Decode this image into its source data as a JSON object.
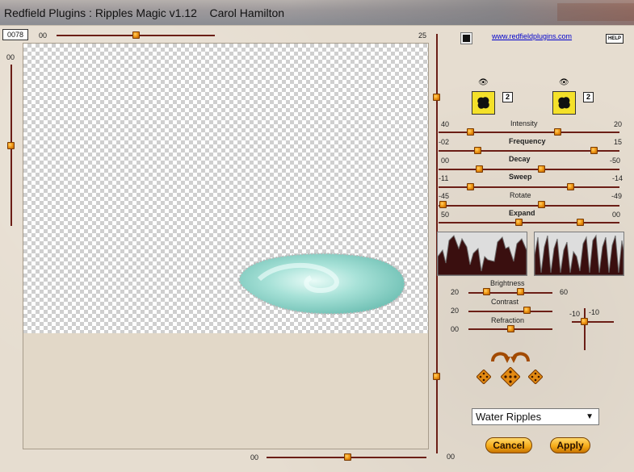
{
  "window": {
    "title": "Redfield Plugins : Ripples Magic v1.12    Carol Hamilton"
  },
  "top_controls": {
    "frame_box": "0078",
    "h_slider_min": "00",
    "h_slider_max": "25",
    "h_slider_value_fraction": 0.5,
    "v_slider_label": "00"
  },
  "bottom_controls": {
    "h_slider_label": "00",
    "right_label": "00"
  },
  "header_right": {
    "link": "www.redfieldplugins.com",
    "help": "HELP"
  },
  "presets": {
    "left_number": "2",
    "right_number": "2"
  },
  "params": [
    {
      "left": "40",
      "name": "Intensity",
      "right": "20",
      "bold": false
    },
    {
      "left": "-02",
      "name": "Frequency",
      "right": "15",
      "bold": true
    },
    {
      "left": "00",
      "name": "Decay",
      "right": "-50",
      "bold": true
    },
    {
      "left": "-11",
      "name": "Sweep",
      "right": "-14",
      "bold": true
    },
    {
      "left": "-45",
      "name": "Rotate",
      "right": "-49",
      "bold": false
    },
    {
      "left": "50",
      "name": "Expand",
      "right": "00",
      "bold": true
    }
  ],
  "lighting": [
    {
      "name": "Brightness",
      "left": "20",
      "right": "60"
    },
    {
      "name": "Contrast",
      "left": "20"
    },
    {
      "name": "Refraction",
      "left": "00"
    }
  ],
  "crosshair": {
    "x_label": "-10",
    "y_label": "-10"
  },
  "preset_select": {
    "value": "Water Ripples"
  },
  "buttons": {
    "cancel": "Cancel",
    "apply": "Apply"
  },
  "colors": {
    "accent": "#f19a16",
    "track": "#6b1e16",
    "panel": "#e6ddd0"
  }
}
